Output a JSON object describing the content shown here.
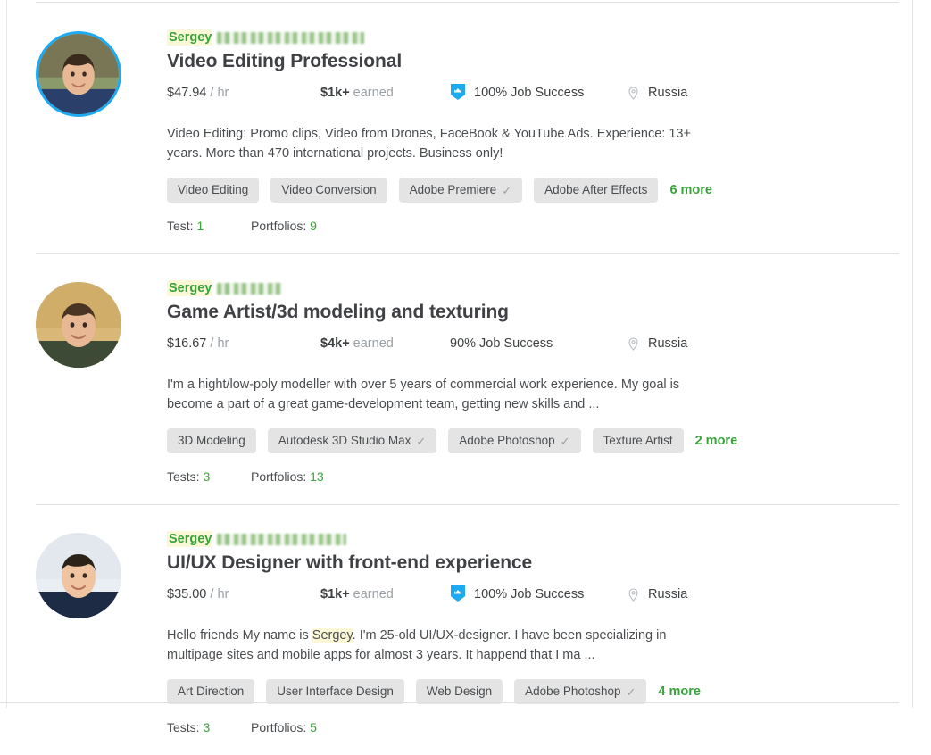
{
  "page": {
    "title": "Freelancer search results"
  },
  "colors": {
    "accent_blue": "#1eaaf1",
    "green": "#3aa23a",
    "tag_bg": "#e4e4e4",
    "text": "#3c3f41",
    "muted": "#9aa0a6",
    "highlight": "#fbf8d8",
    "divider": "#e0e0e0"
  },
  "freelancers": [
    {
      "name": "Sergey",
      "surname_redacted": true,
      "surname_blur_width": 165,
      "title": "Video Editing Professional",
      "rate": "$47.94",
      "rate_suffix": "/ hr",
      "earned": "$1k+",
      "earned_label": "earned",
      "job_success": "100% Job Success",
      "job_success_percent": 100,
      "top_rated": true,
      "badge_icon": "shield-crown-icon",
      "location": "Russia",
      "location_icon": "map-pin-icon",
      "description": "Video Editing: Promo clips, Video from Drones, FaceBook & YouTube Ads. Experience: 13+ years. More than 470 international projects. Business only!",
      "skills": [
        {
          "label": "Video Editing",
          "verified": false
        },
        {
          "label": "Video Conversion",
          "verified": false
        },
        {
          "label": "Adobe Premiere",
          "verified": true
        },
        {
          "label": "Adobe After Effects",
          "verified": false
        }
      ],
      "more_label": "6 more",
      "tests_label": "Test:",
      "tests_count": "1",
      "portfolios_label": "Portfolios:",
      "portfolios_count": "9"
    },
    {
      "name": "Sergey",
      "surname_redacted": true,
      "surname_blur_width": 73,
      "title": "Game Artist/3d modeling and texturing",
      "rate": "$16.67",
      "rate_suffix": "/ hr",
      "earned": "$4k+",
      "earned_label": "earned",
      "job_success": "90% Job Success",
      "job_success_percent": 90,
      "top_rated": false,
      "badge_icon": null,
      "location": "Russia",
      "location_icon": "map-pin-icon",
      "description": "I'm a hight/low-poly modeller with over 5 years of commercial work experience. My goal is become a part of a great game-development team, getting new skills and ...",
      "skills": [
        {
          "label": "3D Modeling",
          "verified": false
        },
        {
          "label": "Autodesk 3D Studio Max",
          "verified": true
        },
        {
          "label": "Adobe Photoshop",
          "verified": true
        },
        {
          "label": "Texture Artist",
          "verified": false
        }
      ],
      "more_label": "2 more",
      "tests_label": "Tests:",
      "tests_count": "3",
      "portfolios_label": "Portfolios:",
      "portfolios_count": "13"
    },
    {
      "name": "Sergey",
      "surname_redacted": true,
      "surname_blur_width": 145,
      "title": "UI/UX Designer with front-end experience",
      "rate": "$35.00",
      "rate_suffix": "/ hr",
      "earned": "$1k+",
      "earned_label": "earned",
      "job_success": "100% Job Success",
      "job_success_percent": 100,
      "top_rated": true,
      "badge_icon": "shield-crown-icon",
      "location": "Russia",
      "location_icon": "map-pin-icon",
      "description_parts": [
        {
          "text": "Hello friends My name is ",
          "highlight": false
        },
        {
          "text": "Sergey",
          "highlight": true
        },
        {
          "text": ". I'm 25-old UI/UX-designer. I have been specializing in multipage sites and mobile apps for almost 3 years. It happend that I ma ...",
          "highlight": false
        }
      ],
      "skills": [
        {
          "label": "Art Direction",
          "verified": false
        },
        {
          "label": "User Interface Design",
          "verified": false
        },
        {
          "label": "Web Design",
          "verified": false
        },
        {
          "label": "Adobe Photoshop",
          "verified": true
        }
      ],
      "more_label": "4 more",
      "tests_label": "Tests:",
      "tests_count": "3",
      "portfolios_label": "Portfolios:",
      "portfolios_count": "5"
    }
  ]
}
